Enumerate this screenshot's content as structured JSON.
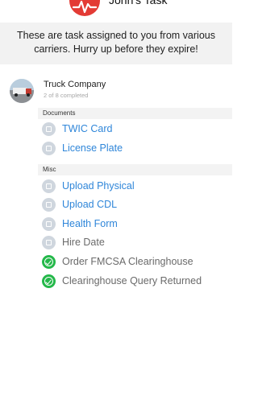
{
  "header": {
    "title": "John's Task",
    "logo_icon": "heartbeat-logo-icon",
    "brand_color": "#e33b35"
  },
  "notice": {
    "text": "These are task assigned to you from various carriers. Hurry up before they expire!"
  },
  "company": {
    "name": "Truck Company",
    "progress": "2 of 8 completed",
    "avatar_icon": "truck-avatar"
  },
  "sections": [
    {
      "title": "Documents",
      "tasks": [
        {
          "label": "TWIC Card",
          "status": "pending",
          "link": true
        },
        {
          "label": "License Plate",
          "status": "pending",
          "link": true
        }
      ]
    },
    {
      "title": "Misc",
      "tasks": [
        {
          "label": "Upload Physical",
          "status": "pending",
          "link": true
        },
        {
          "label": "Upload CDL",
          "status": "pending",
          "link": true
        },
        {
          "label": "Health Form",
          "status": "pending",
          "link": true
        },
        {
          "label": "Hire Date",
          "status": "pending",
          "link": false
        },
        {
          "label": "Order FMCSA Clearinghouse",
          "status": "done",
          "link": false
        },
        {
          "label": "Clearinghouse Query Returned",
          "status": "done",
          "link": false
        }
      ]
    }
  ],
  "colors": {
    "link": "#2f86d9",
    "done": "#24b84a",
    "pending": "#cfd6de"
  }
}
